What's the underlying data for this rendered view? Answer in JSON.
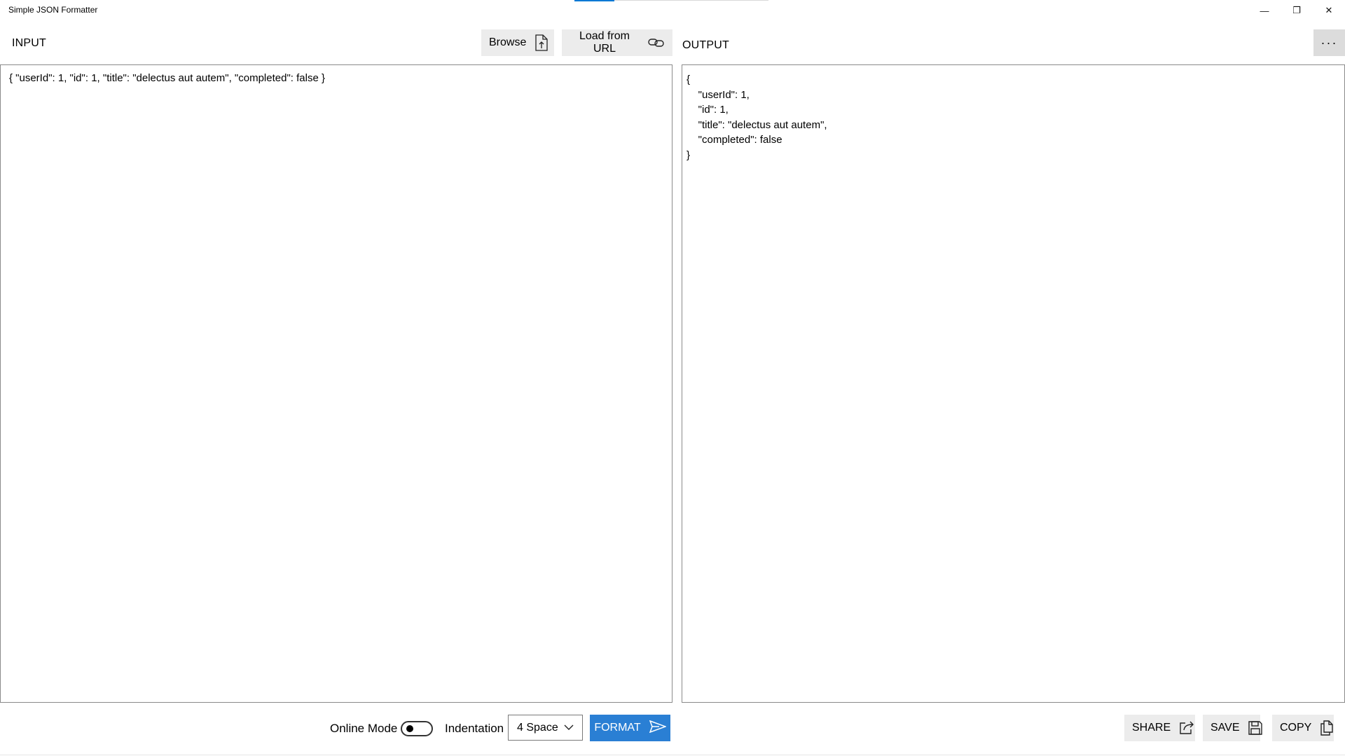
{
  "window": {
    "title": "Simple JSON Formatter",
    "minimize_glyph": "—",
    "maximize_glyph": "❐",
    "close_glyph": "✕"
  },
  "input": {
    "header": "INPUT",
    "browse_label": "Browse",
    "load_url_label": "Load from URL",
    "text": "{ \"userId\": 1, \"id\": 1, \"title\": \"delectus aut autem\", \"completed\": false }"
  },
  "output": {
    "header": "OUTPUT",
    "more_label": "···",
    "lines": [
      "{",
      "    \"userId\": 1,",
      "    \"id\": 1,",
      "    \"title\": \"delectus aut autem\",",
      "    \"completed\": false",
      "}"
    ]
  },
  "toolbar": {
    "online_mode_label": "Online Mode",
    "online_mode_on": false,
    "indentation_label": "Indentation",
    "indentation_value": "4 Space",
    "format_label": "FORMAT",
    "share_label": "SHARE",
    "save_label": "SAVE",
    "copy_label": "COPY"
  },
  "colors": {
    "accent": "#2a7fd4",
    "button_bg": "#ececec"
  },
  "icons": {
    "browse": "file-upload-icon",
    "load_url": "link-icon",
    "format": "send-icon",
    "share": "share-icon",
    "save": "save-icon",
    "copy": "copy-icon",
    "indentation": "chevron-down-icon"
  }
}
